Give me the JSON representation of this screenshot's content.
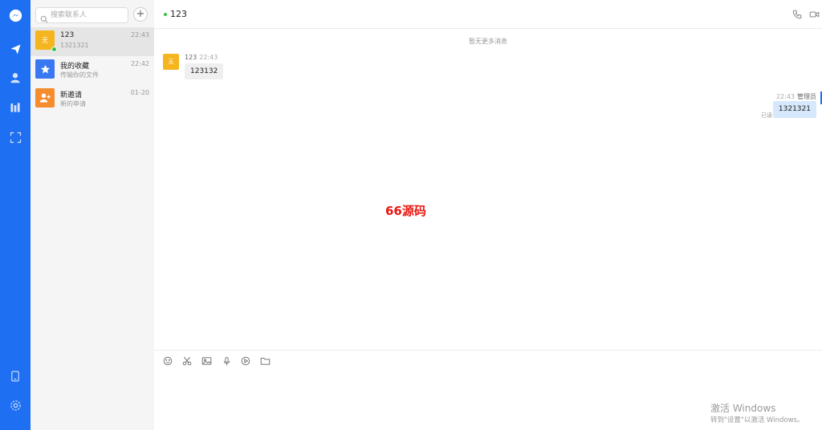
{
  "sidebar": {
    "icons": [
      "messenger-icon",
      "send-icon",
      "user-icon",
      "library-icon",
      "scan-icon",
      "tablet-icon",
      "gear-icon"
    ]
  },
  "contacts": {
    "search_placeholder": "搜索联系人",
    "add_label": "+",
    "items": [
      {
        "avatar_text": "无",
        "avatar_color": "#f5b51f",
        "name": "123",
        "subtitle": "1321321",
        "time": "22:43",
        "online": true
      },
      {
        "avatar_icon": "star-icon",
        "avatar_color": "#3a78f2",
        "name": "我的收藏",
        "subtitle": "传输你的文件",
        "time": "22:42"
      },
      {
        "avatar_icon": "add-user-icon",
        "avatar_color": "#f58c2e",
        "name": "新邀请",
        "subtitle": "新的申请",
        "time": "01-20"
      }
    ]
  },
  "chat": {
    "title": "123",
    "no_more_notice": "暂无更多消息",
    "messages": [
      {
        "side": "left",
        "avatar_text": "无",
        "sender": "123",
        "time": "22:43",
        "text": "123132"
      },
      {
        "side": "right",
        "sender": "管理员",
        "time": "22:43",
        "text": "1321321",
        "status": "已读"
      }
    ]
  },
  "watermark": "66源码",
  "composer": {
    "tools": [
      "emoji-icon",
      "scissors-icon",
      "image-icon",
      "microphone-icon",
      "video-icon",
      "folder-icon"
    ]
  },
  "activation": {
    "line1": "激活 Windows",
    "line2": "转到\"设置\"以激活 Windows。"
  },
  "colors": {
    "accent": "#1e6ff2",
    "online": "#35c14a",
    "watermark": "#e8160f"
  }
}
